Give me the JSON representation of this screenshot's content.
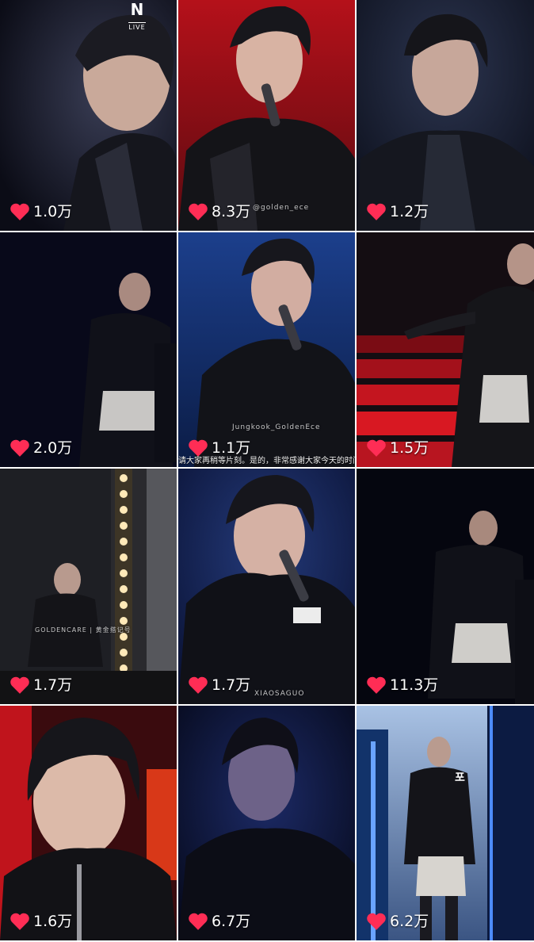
{
  "colors": {
    "heart": "#ff2d55",
    "text": "#ffffff"
  },
  "tiles": [
    {
      "likes": "1.0万",
      "badge": {
        "logo": "N",
        "label": "LIVE"
      }
    },
    {
      "likes": "8.3万",
      "watermark": "@golden_ece"
    },
    {
      "likes": "1.2万"
    },
    {
      "likes": "2.0万"
    },
    {
      "likes": "1.1万",
      "watermark": "Jungkook_GoldenEce",
      "subtitle": "请大家再稍等片刻。是的，非常感谢大家今天的时间。是"
    },
    {
      "likes": "1.5万"
    },
    {
      "likes": "1.7万",
      "watermark": "GOLDENCARE | 黄金搭记号"
    },
    {
      "likes": "1.7万",
      "watermark": "XIAOSAGUO"
    },
    {
      "likes": "11.3万"
    },
    {
      "likes": "1.6万"
    },
    {
      "likes": "6.7万"
    },
    {
      "likes": "6.2万",
      "side_text": "포"
    }
  ]
}
